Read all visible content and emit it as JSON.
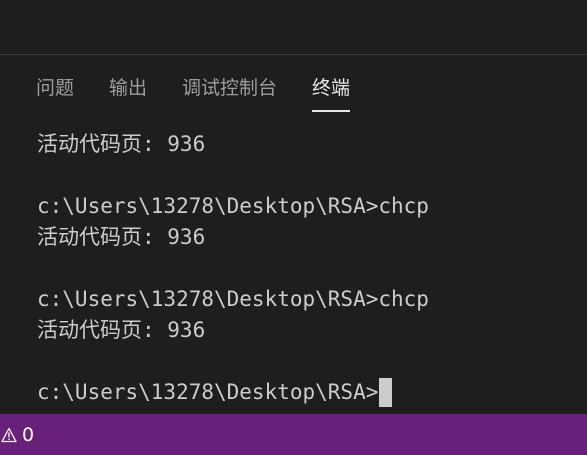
{
  "panel": {
    "tabs": [
      {
        "label": "问题"
      },
      {
        "label": "输出"
      },
      {
        "label": "调试控制台"
      },
      {
        "label": "终端"
      }
    ],
    "active_tab": "终端"
  },
  "terminal": {
    "lines": [
      "活动代码页: 936",
      "",
      "c:\\Users\\13278\\Desktop\\RSA>chcp",
      "活动代码页: 936",
      "",
      "c:\\Users\\13278\\Desktop\\RSA>chcp",
      "活动代码页: 936",
      "",
      "c:\\Users\\13278\\Desktop\\RSA>"
    ]
  },
  "statusbar": {
    "warning_icon": "warning-icon",
    "warning_count": "0",
    "color": "#68217a"
  }
}
